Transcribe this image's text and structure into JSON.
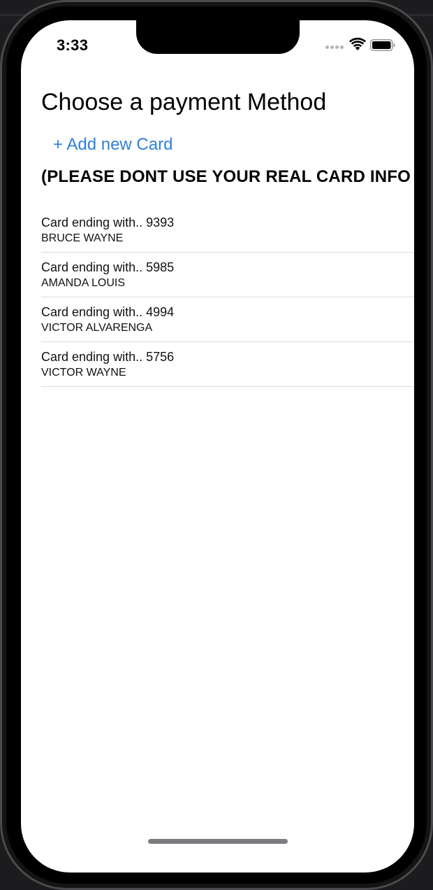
{
  "status_bar": {
    "time": "3:33"
  },
  "page": {
    "title": "Choose a payment Method",
    "add_card_label": "+ Add new Card",
    "warning": "(PLEASE DONT USE YOUR REAL CARD INFO"
  },
  "cards": [
    {
      "title": "Card ending with.. 9393",
      "holder": "BRUCE WAYNE"
    },
    {
      "title": "Card ending with.. 5985",
      "holder": "AMANDA LOUIS"
    },
    {
      "title": "Card ending with.. 4994",
      "holder": "VICTOR ALVARENGA"
    },
    {
      "title": "Card ending with.. 5756",
      "holder": "VICTOR WAYNE"
    }
  ],
  "colors": {
    "accent": "#2f80d9",
    "separator": "#dcdcdf",
    "background": "#ffffff"
  },
  "icons": [
    "wifi-icon",
    "battery-icon",
    "cellular-signal-icon"
  ]
}
